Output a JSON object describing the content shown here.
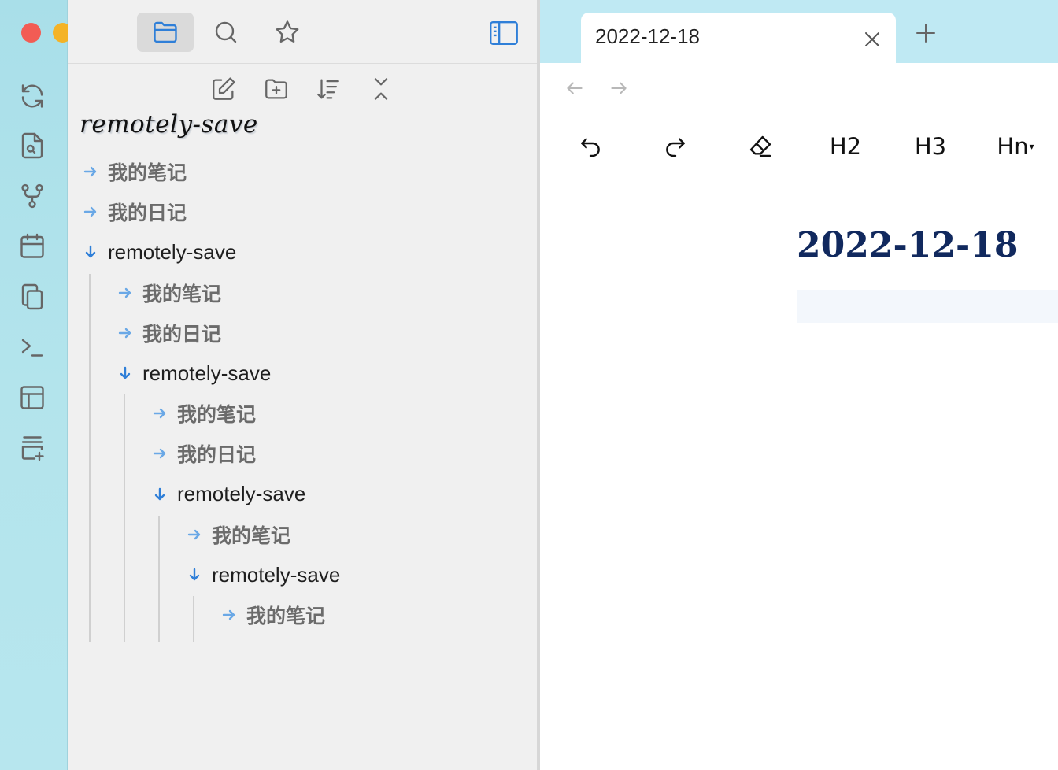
{
  "window": {
    "traffic_lights": {
      "close_color": "#f25c54",
      "minimize_color": "#f4b326",
      "maximize_color": "#36c44a"
    }
  },
  "ribbon": {
    "icons": [
      "sync-icon",
      "file-search-icon",
      "graph-icon",
      "calendar-icon",
      "copy-icon",
      "terminal-icon",
      "layout-icon",
      "add-card-icon"
    ]
  },
  "sidebar": {
    "tab_icons": [
      "folder-icon",
      "search-icon",
      "star-icon",
      "sidebar-toggle-icon"
    ],
    "nav_action_icons": [
      "new-note-icon",
      "new-folder-icon",
      "sort-icon",
      "collapse-all-icon"
    ],
    "vault_title": "remotely-save",
    "tree": [
      {
        "label": "我的笔记",
        "type": "file",
        "depth": 0
      },
      {
        "label": "我的日记",
        "type": "file",
        "depth": 0
      },
      {
        "label": "remotely-save",
        "type": "folder",
        "depth": 0,
        "expanded": true
      },
      {
        "label": "我的笔记",
        "type": "file",
        "depth": 1
      },
      {
        "label": "我的日记",
        "type": "file",
        "depth": 1
      },
      {
        "label": "remotely-save",
        "type": "folder",
        "depth": 1,
        "expanded": true
      },
      {
        "label": "我的笔记",
        "type": "file",
        "depth": 2
      },
      {
        "label": "我的日记",
        "type": "file",
        "depth": 2
      },
      {
        "label": "remotely-save",
        "type": "folder",
        "depth": 2,
        "expanded": true
      },
      {
        "label": "我的笔记",
        "type": "file",
        "depth": 3
      },
      {
        "label": "remotely-save",
        "type": "folder",
        "depth": 3,
        "expanded": true
      },
      {
        "label": "我的笔记",
        "type": "file",
        "depth": 4
      }
    ]
  },
  "editor": {
    "tab_title": "2022-12-18",
    "toolbar": {
      "h2_label": "H2",
      "h3_label": "H3",
      "hn_label": "Hn"
    },
    "document_title": "2022-12-18"
  },
  "colors": {
    "accent": "#2f7fd8",
    "file_arrow": "#6aa8e6",
    "title": "#11295e",
    "tabbar_bg": "#bfe9f3"
  }
}
